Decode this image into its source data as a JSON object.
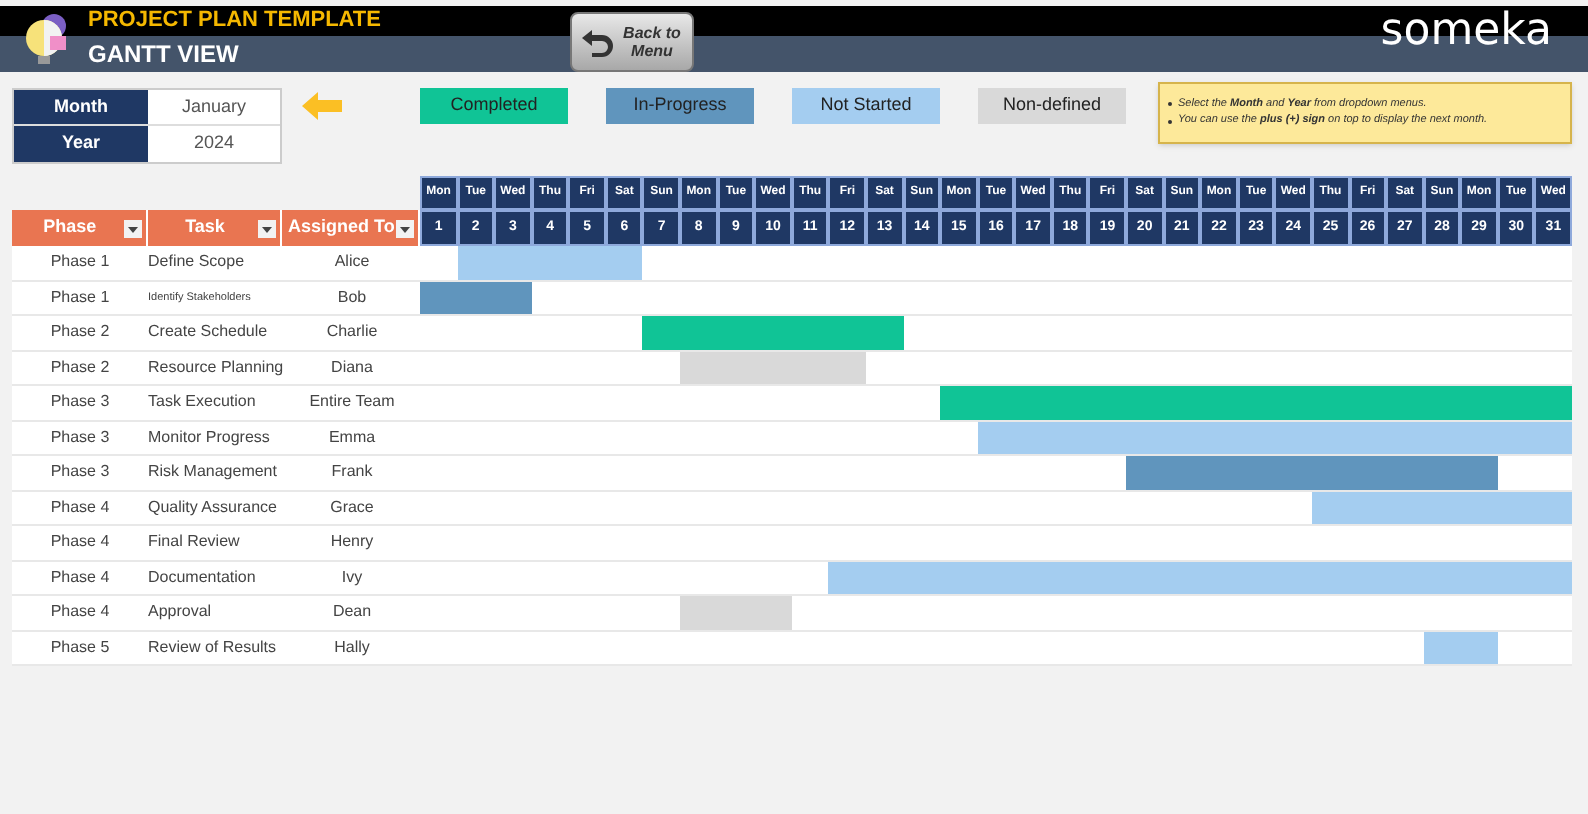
{
  "header": {
    "subtitle": "PROJECT PLAN TEMPLATE",
    "title": "GANTT VIEW",
    "back_button": "Back to Menu",
    "brand": "someka"
  },
  "selectors": [
    {
      "label": "Month",
      "value": "January"
    },
    {
      "label": "Year",
      "value": "2024"
    }
  ],
  "legend": [
    {
      "kind": "completed",
      "label": "Completed"
    },
    {
      "kind": "in_progress",
      "label": "In-Progress"
    },
    {
      "kind": "not_started",
      "label": "Not Started"
    },
    {
      "kind": "non_defined",
      "label": "Non-defined"
    }
  ],
  "notes": [
    "Select the **Month** and **Year** from dropdown menus.",
    "You can use the **plus (+) sign** on top to display the next month."
  ],
  "columns": [
    "Phase",
    "Task",
    "Assigned To"
  ],
  "days": [
    {
      "weekday": "Mon",
      "date": "1"
    },
    {
      "weekday": "Tue",
      "date": "2"
    },
    {
      "weekday": "Wed",
      "date": "3"
    },
    {
      "weekday": "Thu",
      "date": "4"
    },
    {
      "weekday": "Fri",
      "date": "5"
    },
    {
      "weekday": "Sat",
      "date": "6"
    },
    {
      "weekday": "Sun",
      "date": "7"
    },
    {
      "weekday": "Mon",
      "date": "8"
    },
    {
      "weekday": "Tue",
      "date": "9"
    },
    {
      "weekday": "Wed",
      "date": "10"
    },
    {
      "weekday": "Thu",
      "date": "11"
    },
    {
      "weekday": "Fri",
      "date": "12"
    },
    {
      "weekday": "Sat",
      "date": "13"
    },
    {
      "weekday": "Sun",
      "date": "14"
    },
    {
      "weekday": "Mon",
      "date": "15"
    },
    {
      "weekday": "Tue",
      "date": "16"
    },
    {
      "weekday": "Wed",
      "date": "17"
    },
    {
      "weekday": "Thu",
      "date": "18"
    },
    {
      "weekday": "Fri",
      "date": "19"
    },
    {
      "weekday": "Sat",
      "date": "20"
    },
    {
      "weekday": "Sun",
      "date": "21"
    },
    {
      "weekday": "Mon",
      "date": "22"
    },
    {
      "weekday": "Tue",
      "date": "23"
    },
    {
      "weekday": "Wed",
      "date": "24"
    },
    {
      "weekday": "Thu",
      "date": "25"
    },
    {
      "weekday": "Fri",
      "date": "26"
    },
    {
      "weekday": "Sat",
      "date": "27"
    },
    {
      "weekday": "Sun",
      "date": "28"
    },
    {
      "weekday": "Mon",
      "date": "29"
    },
    {
      "weekday": "Tue",
      "date": "30"
    },
    {
      "weekday": "Wed",
      "date": "31"
    }
  ],
  "rows": [
    {
      "phase": "Phase 1",
      "task": "Define Scope",
      "assigned_to": "Alice",
      "cells": [
        {
          "kind": "none"
        },
        {
          "kind": "not_started"
        },
        {
          "kind": "not_started"
        },
        {
          "kind": "not_started"
        },
        {
          "kind": "not_started"
        },
        {
          "kind": "not_started"
        },
        {
          "kind": "none"
        },
        {
          "kind": "none"
        },
        {
          "kind": "none"
        },
        {
          "kind": "none"
        },
        {
          "kind": "none"
        },
        {
          "kind": "none"
        },
        {
          "kind": "none"
        },
        {
          "kind": "none"
        },
        {
          "kind": "none"
        },
        {
          "kind": "none"
        },
        {
          "kind": "none"
        },
        {
          "kind": "none"
        },
        {
          "kind": "none"
        },
        {
          "kind": "none"
        },
        {
          "kind": "none"
        },
        {
          "kind": "none"
        },
        {
          "kind": "none"
        },
        {
          "kind": "none"
        },
        {
          "kind": "none"
        },
        {
          "kind": "none"
        },
        {
          "kind": "none"
        },
        {
          "kind": "none"
        },
        {
          "kind": "none"
        },
        {
          "kind": "none"
        },
        {
          "kind": "none"
        }
      ]
    },
    {
      "phase": "Phase 1",
      "task": "Identify Stakeholders",
      "small": true,
      "assigned_to": "Bob",
      "cells": [
        {
          "kind": "in_progress"
        },
        {
          "kind": "in_progress"
        },
        {
          "kind": "in_progress"
        },
        {
          "kind": "none"
        },
        {
          "kind": "none"
        },
        {
          "kind": "none"
        },
        {
          "kind": "none"
        },
        {
          "kind": "none"
        },
        {
          "kind": "none"
        },
        {
          "kind": "none"
        },
        {
          "kind": "none"
        },
        {
          "kind": "none"
        },
        {
          "kind": "none"
        },
        {
          "kind": "none"
        },
        {
          "kind": "none"
        },
        {
          "kind": "none"
        },
        {
          "kind": "none"
        },
        {
          "kind": "none"
        },
        {
          "kind": "none"
        },
        {
          "kind": "none"
        },
        {
          "kind": "none"
        },
        {
          "kind": "none"
        },
        {
          "kind": "none"
        },
        {
          "kind": "none"
        },
        {
          "kind": "none"
        },
        {
          "kind": "none"
        },
        {
          "kind": "none"
        },
        {
          "kind": "none"
        },
        {
          "kind": "none"
        },
        {
          "kind": "none"
        },
        {
          "kind": "none"
        }
      ]
    },
    {
      "phase": "Phase 2",
      "task": "Create Schedule",
      "assigned_to": "Charlie",
      "cells": [
        {
          "kind": "none"
        },
        {
          "kind": "none"
        },
        {
          "kind": "none"
        },
        {
          "kind": "none"
        },
        {
          "kind": "none"
        },
        {
          "kind": "none"
        },
        {
          "kind": "completed"
        },
        {
          "kind": "completed"
        },
        {
          "kind": "completed"
        },
        {
          "kind": "completed"
        },
        {
          "kind": "completed"
        },
        {
          "kind": "completed"
        },
        {
          "kind": "completed"
        },
        {
          "kind": "none"
        },
        {
          "kind": "none"
        },
        {
          "kind": "none"
        },
        {
          "kind": "none"
        },
        {
          "kind": "none"
        },
        {
          "kind": "none"
        },
        {
          "kind": "none"
        },
        {
          "kind": "none"
        },
        {
          "kind": "none"
        },
        {
          "kind": "none"
        },
        {
          "kind": "none"
        },
        {
          "kind": "none"
        },
        {
          "kind": "none"
        },
        {
          "kind": "none"
        },
        {
          "kind": "none"
        },
        {
          "kind": "none"
        },
        {
          "kind": "none"
        },
        {
          "kind": "none"
        }
      ]
    },
    {
      "phase": "Phase 2",
      "task": "Resource Planning",
      "assigned_to": "Diana",
      "cells": [
        {
          "kind": "none"
        },
        {
          "kind": "none"
        },
        {
          "kind": "none"
        },
        {
          "kind": "none"
        },
        {
          "kind": "none"
        },
        {
          "kind": "none"
        },
        {
          "kind": "none"
        },
        {
          "kind": "non_defined"
        },
        {
          "kind": "non_defined"
        },
        {
          "kind": "non_defined"
        },
        {
          "kind": "non_defined"
        },
        {
          "kind": "non_defined"
        },
        {
          "kind": "none"
        },
        {
          "kind": "none"
        },
        {
          "kind": "none"
        },
        {
          "kind": "none"
        },
        {
          "kind": "none"
        },
        {
          "kind": "none"
        },
        {
          "kind": "none"
        },
        {
          "kind": "none"
        },
        {
          "kind": "none"
        },
        {
          "kind": "none"
        },
        {
          "kind": "none"
        },
        {
          "kind": "none"
        },
        {
          "kind": "none"
        },
        {
          "kind": "none"
        },
        {
          "kind": "none"
        },
        {
          "kind": "none"
        },
        {
          "kind": "none"
        },
        {
          "kind": "none"
        },
        {
          "kind": "none"
        }
      ]
    },
    {
      "phase": "Phase 3",
      "task": "Task Execution",
      "assigned_to": "Entire Team",
      "cells": [
        {
          "kind": "none"
        },
        {
          "kind": "none"
        },
        {
          "kind": "none"
        },
        {
          "kind": "none"
        },
        {
          "kind": "none"
        },
        {
          "kind": "none"
        },
        {
          "kind": "none"
        },
        {
          "kind": "none"
        },
        {
          "kind": "none"
        },
        {
          "kind": "none"
        },
        {
          "kind": "none"
        },
        {
          "kind": "none"
        },
        {
          "kind": "none"
        },
        {
          "kind": "none"
        },
        {
          "kind": "completed"
        },
        {
          "kind": "completed"
        },
        {
          "kind": "completed"
        },
        {
          "kind": "completed"
        },
        {
          "kind": "completed"
        },
        {
          "kind": "completed"
        },
        {
          "kind": "completed"
        },
        {
          "kind": "completed"
        },
        {
          "kind": "completed"
        },
        {
          "kind": "completed"
        },
        {
          "kind": "completed"
        },
        {
          "kind": "completed"
        },
        {
          "kind": "completed"
        },
        {
          "kind": "completed"
        },
        {
          "kind": "completed"
        },
        {
          "kind": "completed"
        },
        {
          "kind": "completed"
        }
      ]
    },
    {
      "phase": "Phase 3",
      "task": "Monitor Progress",
      "assigned_to": "Emma",
      "cells": [
        {
          "kind": "none"
        },
        {
          "kind": "none"
        },
        {
          "kind": "none"
        },
        {
          "kind": "none"
        },
        {
          "kind": "none"
        },
        {
          "kind": "none"
        },
        {
          "kind": "none"
        },
        {
          "kind": "none"
        },
        {
          "kind": "none"
        },
        {
          "kind": "none"
        },
        {
          "kind": "none"
        },
        {
          "kind": "none"
        },
        {
          "kind": "none"
        },
        {
          "kind": "none"
        },
        {
          "kind": "none"
        },
        {
          "kind": "not_started"
        },
        {
          "kind": "not_started"
        },
        {
          "kind": "not_started"
        },
        {
          "kind": "not_started"
        },
        {
          "kind": "not_started"
        },
        {
          "kind": "not_started"
        },
        {
          "kind": "not_started"
        },
        {
          "kind": "not_started"
        },
        {
          "kind": "not_started"
        },
        {
          "kind": "not_started"
        },
        {
          "kind": "not_started"
        },
        {
          "kind": "not_started"
        },
        {
          "kind": "not_started"
        },
        {
          "kind": "not_started"
        },
        {
          "kind": "not_started"
        },
        {
          "kind": "not_started"
        }
      ]
    },
    {
      "phase": "Phase 3",
      "task": "Risk Management",
      "assigned_to": "Frank",
      "cells": [
        {
          "kind": "none"
        },
        {
          "kind": "none"
        },
        {
          "kind": "none"
        },
        {
          "kind": "none"
        },
        {
          "kind": "none"
        },
        {
          "kind": "none"
        },
        {
          "kind": "none"
        },
        {
          "kind": "none"
        },
        {
          "kind": "none"
        },
        {
          "kind": "none"
        },
        {
          "kind": "none"
        },
        {
          "kind": "none"
        },
        {
          "kind": "none"
        },
        {
          "kind": "none"
        },
        {
          "kind": "none"
        },
        {
          "kind": "none"
        },
        {
          "kind": "none"
        },
        {
          "kind": "none"
        },
        {
          "kind": "none"
        },
        {
          "kind": "in_progress"
        },
        {
          "kind": "in_progress"
        },
        {
          "kind": "in_progress"
        },
        {
          "kind": "in_progress"
        },
        {
          "kind": "in_progress"
        },
        {
          "kind": "in_progress"
        },
        {
          "kind": "in_progress"
        },
        {
          "kind": "in_progress"
        },
        {
          "kind": "in_progress"
        },
        {
          "kind": "in_progress"
        },
        {
          "kind": "none"
        },
        {
          "kind": "none"
        }
      ]
    },
    {
      "phase": "Phase 4",
      "task": "Quality Assurance",
      "assigned_to": "Grace",
      "cells": [
        {
          "kind": "none"
        },
        {
          "kind": "none"
        },
        {
          "kind": "none"
        },
        {
          "kind": "none"
        },
        {
          "kind": "none"
        },
        {
          "kind": "none"
        },
        {
          "kind": "none"
        },
        {
          "kind": "none"
        },
        {
          "kind": "none"
        },
        {
          "kind": "none"
        },
        {
          "kind": "none"
        },
        {
          "kind": "none"
        },
        {
          "kind": "none"
        },
        {
          "kind": "none"
        },
        {
          "kind": "none"
        },
        {
          "kind": "none"
        },
        {
          "kind": "none"
        },
        {
          "kind": "none"
        },
        {
          "kind": "none"
        },
        {
          "kind": "none"
        },
        {
          "kind": "none"
        },
        {
          "kind": "none"
        },
        {
          "kind": "none"
        },
        {
          "kind": "none"
        },
        {
          "kind": "not_started"
        },
        {
          "kind": "not_started"
        },
        {
          "kind": "not_started"
        },
        {
          "kind": "not_started"
        },
        {
          "kind": "not_started"
        },
        {
          "kind": "not_started"
        },
        {
          "kind": "not_started"
        }
      ]
    },
    {
      "phase": "Phase 4",
      "task": "Final Review",
      "assigned_to": "Henry",
      "cells": [
        {
          "kind": "none"
        },
        {
          "kind": "none"
        },
        {
          "kind": "none"
        },
        {
          "kind": "none"
        },
        {
          "kind": "none"
        },
        {
          "kind": "none"
        },
        {
          "kind": "none"
        },
        {
          "kind": "none"
        },
        {
          "kind": "none"
        },
        {
          "kind": "none"
        },
        {
          "kind": "none"
        },
        {
          "kind": "none"
        },
        {
          "kind": "none"
        },
        {
          "kind": "none"
        },
        {
          "kind": "none"
        },
        {
          "kind": "none"
        },
        {
          "kind": "none"
        },
        {
          "kind": "none"
        },
        {
          "kind": "none"
        },
        {
          "kind": "none"
        },
        {
          "kind": "none"
        },
        {
          "kind": "none"
        },
        {
          "kind": "none"
        },
        {
          "kind": "none"
        },
        {
          "kind": "none"
        },
        {
          "kind": "none"
        },
        {
          "kind": "none"
        },
        {
          "kind": "none"
        },
        {
          "kind": "none"
        },
        {
          "kind": "none"
        },
        {
          "kind": "none"
        }
      ]
    },
    {
      "phase": "Phase 4",
      "task": "Documentation",
      "assigned_to": "Ivy",
      "cells": [
        {
          "kind": "none"
        },
        {
          "kind": "none"
        },
        {
          "kind": "none"
        },
        {
          "kind": "none"
        },
        {
          "kind": "none"
        },
        {
          "kind": "none"
        },
        {
          "kind": "none"
        },
        {
          "kind": "none"
        },
        {
          "kind": "none"
        },
        {
          "kind": "none"
        },
        {
          "kind": "none"
        },
        {
          "kind": "not_started"
        },
        {
          "kind": "not_started"
        },
        {
          "kind": "not_started"
        },
        {
          "kind": "not_started"
        },
        {
          "kind": "not_started"
        },
        {
          "kind": "not_started"
        },
        {
          "kind": "not_started"
        },
        {
          "kind": "not_started"
        },
        {
          "kind": "not_started"
        },
        {
          "kind": "not_started"
        },
        {
          "kind": "not_started"
        },
        {
          "kind": "not_started"
        },
        {
          "kind": "not_started"
        },
        {
          "kind": "not_started"
        },
        {
          "kind": "not_started"
        },
        {
          "kind": "not_started"
        },
        {
          "kind": "not_started"
        },
        {
          "kind": "not_started"
        },
        {
          "kind": "not_started"
        },
        {
          "kind": "not_started"
        }
      ]
    },
    {
      "phase": "Phase 4",
      "task": "Approval",
      "assigned_to": "Dean",
      "cells": [
        {
          "kind": "none"
        },
        {
          "kind": "none"
        },
        {
          "kind": "none"
        },
        {
          "kind": "none"
        },
        {
          "kind": "none"
        },
        {
          "kind": "none"
        },
        {
          "kind": "none"
        },
        {
          "kind": "non_defined"
        },
        {
          "kind": "non_defined"
        },
        {
          "kind": "non_defined"
        },
        {
          "kind": "none"
        },
        {
          "kind": "none"
        },
        {
          "kind": "none"
        },
        {
          "kind": "none"
        },
        {
          "kind": "none"
        },
        {
          "kind": "none"
        },
        {
          "kind": "none"
        },
        {
          "kind": "none"
        },
        {
          "kind": "none"
        },
        {
          "kind": "none"
        },
        {
          "kind": "none"
        },
        {
          "kind": "none"
        },
        {
          "kind": "none"
        },
        {
          "kind": "none"
        },
        {
          "kind": "none"
        },
        {
          "kind": "none"
        },
        {
          "kind": "none"
        },
        {
          "kind": "none"
        },
        {
          "kind": "none"
        },
        {
          "kind": "none"
        },
        {
          "kind": "none"
        }
      ]
    },
    {
      "phase": "Phase 5",
      "task": "Review of Results",
      "assigned_to": "Hally",
      "cells": [
        {
          "kind": "none"
        },
        {
          "kind": "none"
        },
        {
          "kind": "none"
        },
        {
          "kind": "none"
        },
        {
          "kind": "none"
        },
        {
          "kind": "none"
        },
        {
          "kind": "none"
        },
        {
          "kind": "none"
        },
        {
          "kind": "none"
        },
        {
          "kind": "none"
        },
        {
          "kind": "none"
        },
        {
          "kind": "none"
        },
        {
          "kind": "none"
        },
        {
          "kind": "none"
        },
        {
          "kind": "none"
        },
        {
          "kind": "none"
        },
        {
          "kind": "none"
        },
        {
          "kind": "none"
        },
        {
          "kind": "none"
        },
        {
          "kind": "none"
        },
        {
          "kind": "none"
        },
        {
          "kind": "none"
        },
        {
          "kind": "none"
        },
        {
          "kind": "none"
        },
        {
          "kind": "none"
        },
        {
          "kind": "none"
        },
        {
          "kind": "none"
        },
        {
          "kind": "not_started"
        },
        {
          "kind": "not_started"
        },
        {
          "kind": "none"
        },
        {
          "kind": "none"
        }
      ]
    }
  ]
}
